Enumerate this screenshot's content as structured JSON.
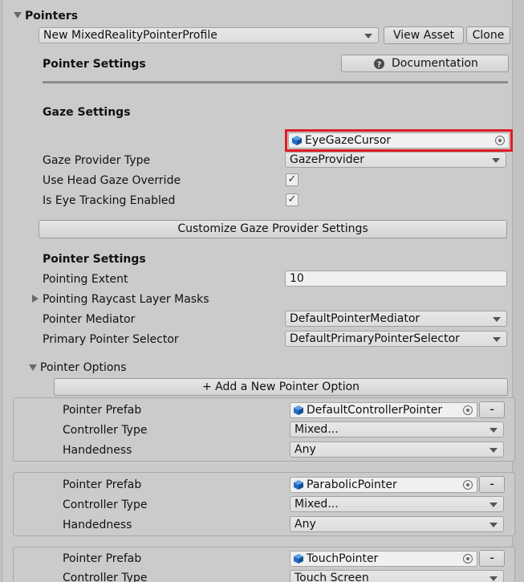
{
  "header": {
    "section_title": "Pointers",
    "profile_dropdown": "New MixedRealityPointerProfile",
    "view_asset_label": "View Asset",
    "clone_label": "Clone"
  },
  "pointer_settings_heading": "Pointer Settings",
  "documentation_label": "Documentation",
  "gaze": {
    "heading": "Gaze Settings",
    "cursor_value": "EyeGazeCursor",
    "provider_type_label": "Gaze Provider Type",
    "provider_type_value": "GazeProvider",
    "head_gaze_override_label": "Use Head Gaze Override",
    "head_gaze_override_checked": "✓",
    "eye_tracking_label": "Is Eye Tracking Enabled",
    "eye_tracking_checked": "✓",
    "customize_button": "Customize Gaze Provider Settings"
  },
  "pointer": {
    "heading": "Pointer Settings",
    "extent_label": "Pointing Extent",
    "extent_value": "10",
    "raycast_label": "Pointing Raycast Layer Masks",
    "mediator_label": "Pointer Mediator",
    "mediator_value": "DefaultPointerMediator",
    "selector_label": "Primary Pointer Selector",
    "selector_value": "DefaultPrimaryPointerSelector"
  },
  "options": {
    "heading": "Pointer Options",
    "add_button": "+ Add a New Pointer Option",
    "prefab_label": "Pointer Prefab",
    "controller_label": "Controller Type",
    "handedness_label": "Handedness",
    "remove_label": "-",
    "items": [
      {
        "prefab": "DefaultControllerPointer",
        "controller": "Mixed...",
        "handedness": "Any"
      },
      {
        "prefab": "ParabolicPointer",
        "controller": "Mixed...",
        "handedness": "Any"
      },
      {
        "prefab": "TouchPointer",
        "controller": "Touch Screen",
        "handedness": ""
      }
    ]
  },
  "colors": {
    "highlight": "#e01b24",
    "cube_icon": "#1f6fc4"
  },
  "icons": {
    "foldout_open": "triangle-down-icon",
    "foldout_closed": "triangle-right-icon",
    "help": "question-circle-icon",
    "object": "prefab-cube-icon",
    "picker": "object-picker-icon"
  }
}
